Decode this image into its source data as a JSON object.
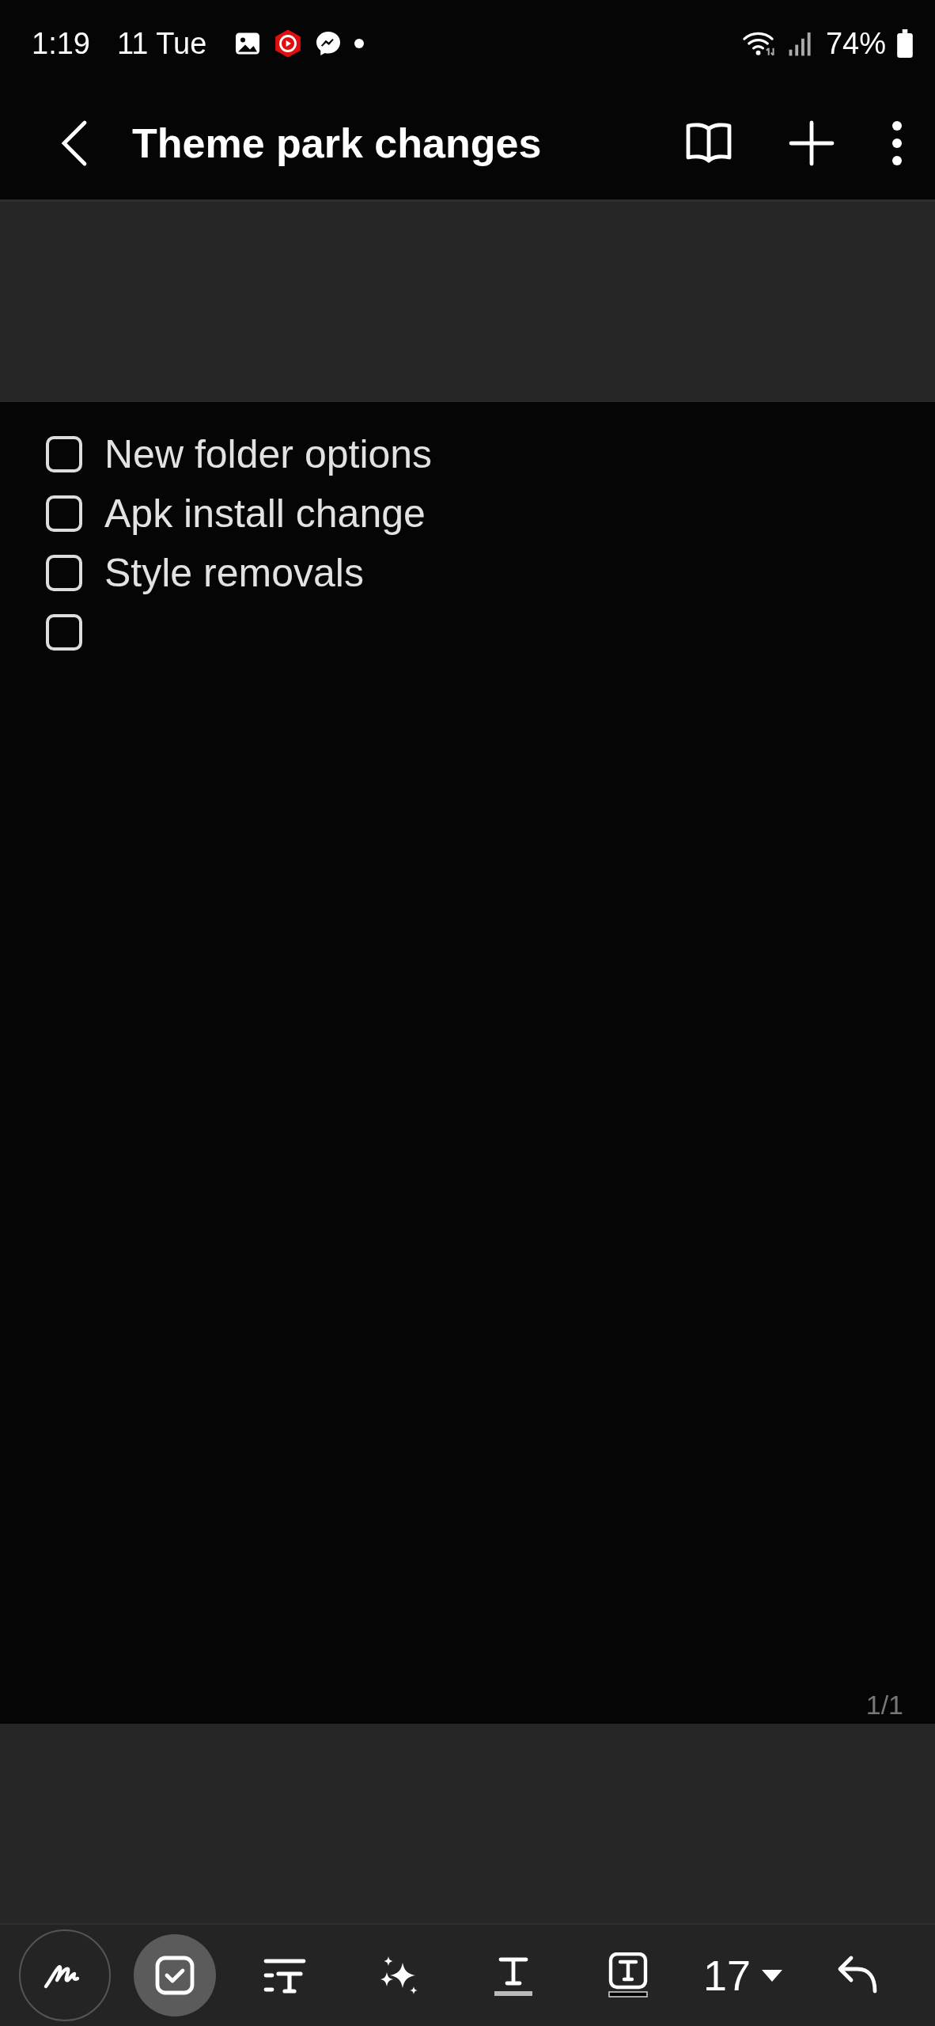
{
  "status_bar": {
    "time": "1:19",
    "date": "11 Tue",
    "battery": "74%"
  },
  "header": {
    "title": "Theme park changes"
  },
  "checklist": [
    {
      "text": "New folder options",
      "checked": false
    },
    {
      "text": "Apk install change",
      "checked": false
    },
    {
      "text": "Style removals",
      "checked": false
    },
    {
      "checked": false
    }
  ],
  "page_indicator": "1/1",
  "toolbar": [
    {
      "kind": "handwriting",
      "selected": false
    },
    {
      "kind": "checklist",
      "selected": true
    },
    {
      "kind": "paragraph",
      "selected": false
    },
    {
      "kind": "ai",
      "selected": false
    },
    {
      "kind": "text-color",
      "selected": false
    },
    {
      "kind": "text-background",
      "selected": false
    },
    {
      "kind": "font-size",
      "label": "17"
    },
    {
      "kind": "undo"
    }
  ]
}
